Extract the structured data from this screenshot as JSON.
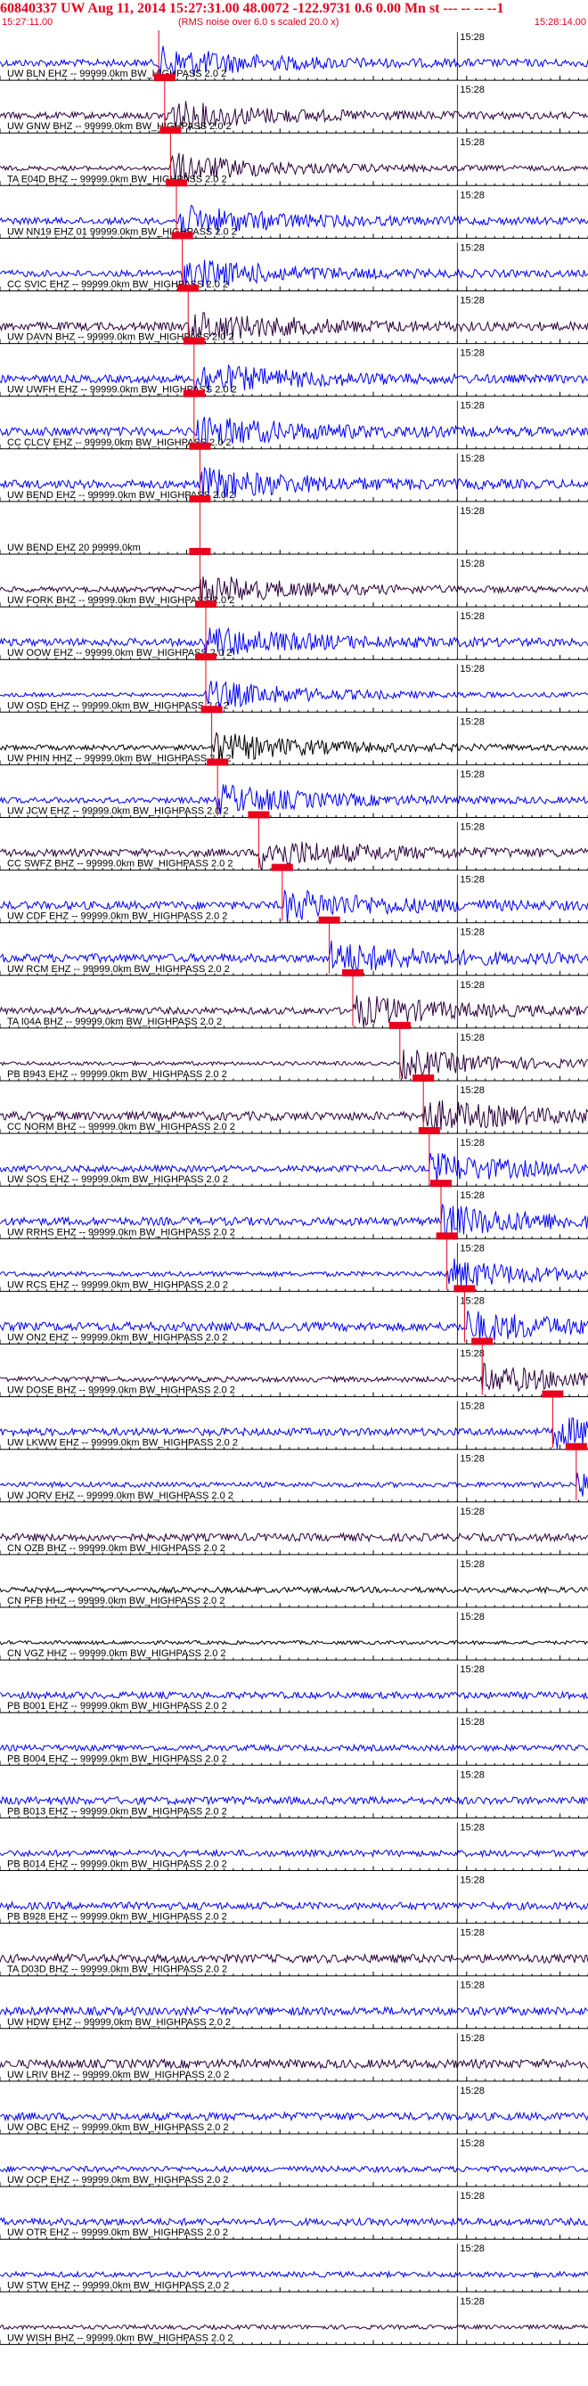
{
  "header": {
    "title": "60840337 UW Aug 11, 2014 15:27:31.00   48.0072 -122.9731  0.6 0.00 Mn st --- -- -- --1",
    "title_right": "-1",
    "start_time": "15:27:11.00",
    "rms_note": "(RMS noise over 6.0 s scaled 20.0 x)",
    "end_time": "15:28:14.00"
  },
  "colors": {
    "title": "#e8001c",
    "trace_blue": "#0000ff",
    "trace_dark": "#2a003a",
    "trace_black": "#000000",
    "pick_box": "#e8001c",
    "axis": "#000000"
  },
  "chart_data": {
    "type": "line",
    "title": "60840337 UW Aug 11, 2014 15:27:31.00",
    "x_range": [
      "15:27:11.00",
      "15:28:14.00"
    ],
    "time_mark": "15:28",
    "traces": [
      {
        "label": "UW BLN EHZ -- 99999.0km BW_HIGHPASS  2.0  2",
        "color": "blue",
        "pick": 0.27
      },
      {
        "label": "UW GNW BHZ -- 99999.0km BW_HIGHPASS  2.0  2",
        "color": "dark",
        "pick": 0.28
      },
      {
        "label": "TA E04D BHZ -- 99999.0km BW_HIGHPASS  2.0  2",
        "color": "dark",
        "pick": 0.29
      },
      {
        "label": "UW NN19 EHZ 01 99999.0km BW_HIGHPASS  2.0  2",
        "color": "blue",
        "pick": 0.3
      },
      {
        "label": "CC SVIC EHZ -- 99999.0km BW_HIGHPASS  2.0  2",
        "color": "blue",
        "pick": 0.31
      },
      {
        "label": "UW DAVN BHZ -- 99999.0km BW_HIGHPASS  2.0  2",
        "color": "dark",
        "pick": 0.32
      },
      {
        "label": "UW UWFH EHZ -- 99999.0km BW_HIGHPASS  2.0  2",
        "color": "blue",
        "pick": 0.33
      },
      {
        "label": "CC CLCV EHZ -- 99999.0km BW_HIGHPASS  2.0  2",
        "color": "blue",
        "pick": 0.33
      },
      {
        "label": "UW BEND EHZ -- 99999.0km BW_HIGHPASS  2.0  2",
        "color": "blue",
        "pick": 0.34
      },
      {
        "label": "UW BEND EHZ 20 99999.0km",
        "color": "none",
        "pick": 0.34
      },
      {
        "label": "UW FORK BHZ -- 99999.0km BW_HIGHPASS  2.0  2",
        "color": "dark",
        "pick": 0.34
      },
      {
        "label": "UW OOW EHZ -- 99999.0km BW_HIGHPASS  2.0  2",
        "color": "blue",
        "pick": 0.35
      },
      {
        "label": "UW OSD EHZ -- 99999.0km BW_HIGHPASS  2.0  2",
        "color": "blue",
        "pick": 0.35
      },
      {
        "label": "UW PHIN HHZ -- 99999.0km BW_HIGHPASS  2.0  2",
        "color": "black",
        "pick": 0.36
      },
      {
        "label": "UW JCW EHZ -- 99999.0km BW_HIGHPASS  2.0  2",
        "color": "blue",
        "pick": 0.37
      },
      {
        "label": "CC SWFZ BHZ -- 99999.0km BW_HIGHPASS  2.0  2",
        "color": "dark",
        "pick": 0.44
      },
      {
        "label": "UW CDF EHZ -- 99999.0km BW_HIGHPASS  2.0  2",
        "color": "blue",
        "pick": 0.48
      },
      {
        "label": "UW RCM EHZ -- 99999.0km BW_HIGHPASS  2.0  2",
        "color": "blue",
        "pick": 0.56
      },
      {
        "label": "TA I04A BHZ -- 99999.0km BW_HIGHPASS  2.0  2",
        "color": "dark",
        "pick": 0.6
      },
      {
        "label": "PB B943 EHZ -- 99999.0km BW_HIGHPASS  2.0  2",
        "color": "dark",
        "pick": 0.68
      },
      {
        "label": "CC NORM BHZ -- 99999.0km BW_HIGHPASS  2.0  2",
        "color": "dark",
        "pick": 0.72
      },
      {
        "label": "UW SOS EHZ -- 99999.0km BW_HIGHPASS  2.0  2",
        "color": "blue",
        "pick": 0.73
      },
      {
        "label": "UW RRHS EHZ -- 99999.0km BW_HIGHPASS  2.0  2",
        "color": "blue",
        "pick": 0.75
      },
      {
        "label": "UW RCS EHZ -- 99999.0km BW_HIGHPASS  2.0  2",
        "color": "blue",
        "pick": 0.76
      },
      {
        "label": "UW ON2 EHZ -- 99999.0km BW_HIGHPASS  2.0  2",
        "color": "blue",
        "pick": 0.79
      },
      {
        "label": "UW DOSE BHZ -- 99999.0km BW_HIGHPASS  2.0  2",
        "color": "dark",
        "pick": 0.82
      },
      {
        "label": "UW LKWW EHZ -- 99999.0km BW_HIGHPASS  2.0  2",
        "color": "blue",
        "pick": 0.94
      },
      {
        "label": "UW JORV EHZ -- 99999.0km BW_HIGHPASS  2.0  2",
        "color": "blue",
        "pick": 0.98
      },
      {
        "label": "CN OZB BHZ -- 99999.0km BW_HIGHPASS  2.0  2",
        "color": "dark",
        "pick": null
      },
      {
        "label": "CN PFB HHZ -- 99999.0km BW_HIGHPASS  2.0  2",
        "color": "black",
        "pick": null
      },
      {
        "label": "CN VGZ HHZ -- 99999.0km BW_HIGHPASS  2.0  2",
        "color": "black",
        "pick": null
      },
      {
        "label": "PB B001 EHZ -- 99999.0km BW_HIGHPASS  2.0  2",
        "color": "blue",
        "pick": null
      },
      {
        "label": "PB B004 EHZ -- 99999.0km BW_HIGHPASS  2.0  2",
        "color": "blue",
        "pick": null
      },
      {
        "label": "PB B013 EHZ -- 99999.0km BW_HIGHPASS  2.0  2",
        "color": "blue",
        "pick": null
      },
      {
        "label": "PB B014 EHZ -- 99999.0km BW_HIGHPASS  2.0  2",
        "color": "blue",
        "pick": null
      },
      {
        "label": "PB B928 EHZ -- 99999.0km BW_HIGHPASS  2.0  2",
        "color": "blue",
        "pick": null
      },
      {
        "label": "TA D03D BHZ -- 99999.0km BW_HIGHPASS  2.0  2",
        "color": "dark",
        "pick": null
      },
      {
        "label": "UW HDW EHZ -- 99999.0km BW_HIGHPASS  2.0  2",
        "color": "blue",
        "pick": null
      },
      {
        "label": "UW LRIV BHZ -- 99999.0km BW_HIGHPASS  2.0  2",
        "color": "dark",
        "pick": null
      },
      {
        "label": "UW OBC EHZ -- 99999.0km BW_HIGHPASS  2.0  2",
        "color": "blue",
        "pick": null
      },
      {
        "label": "UW OCP EHZ -- 99999.0km BW_HIGHPASS  2.0  2",
        "color": "blue",
        "pick": null
      },
      {
        "label": "UW OTR EHZ -- 99999.0km BW_HIGHPASS  2.0  2",
        "color": "blue",
        "pick": null
      },
      {
        "label": "UW STW EHZ -- 99999.0km BW_HIGHPASS  2.0  2",
        "color": "blue",
        "pick": null
      },
      {
        "label": "UW WISH BHZ -- 99999.0km BW_HIGHPASS  2.0  2",
        "color": "dark",
        "pick": null
      }
    ]
  }
}
